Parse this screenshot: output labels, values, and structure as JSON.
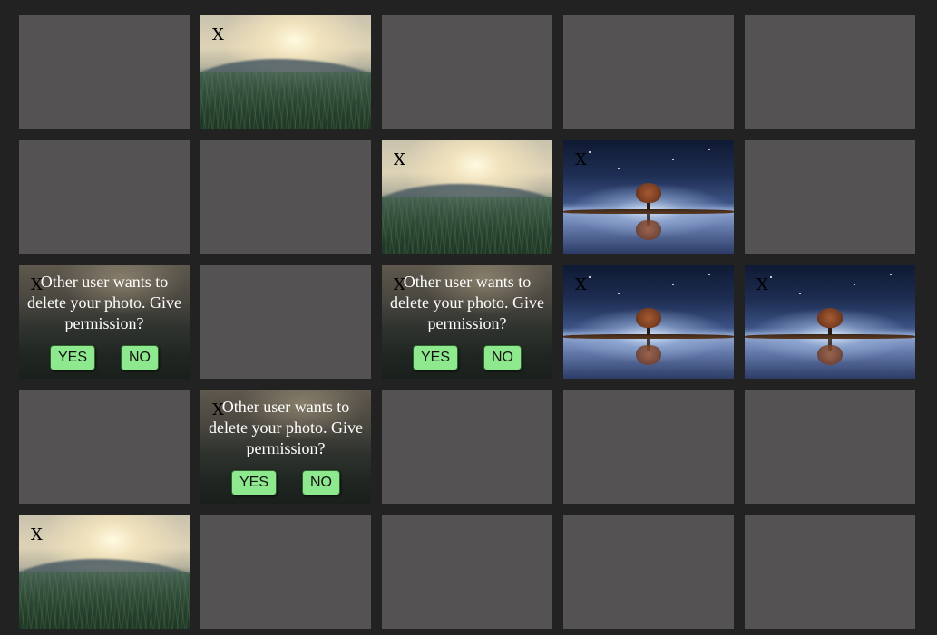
{
  "close_label": "X",
  "permission": {
    "message": "Other user wants to delete your photo. Give permission?",
    "yes_label": "YES",
    "no_label": "NO"
  },
  "colors": {
    "page_background": "#222222",
    "empty_tile": "#545253",
    "button_green": "#8ee88e"
  },
  "grid": {
    "rows": 5,
    "columns": 5,
    "tiles": [
      [
        "empty",
        "meadow",
        "empty",
        "empty",
        "empty"
      ],
      [
        "empty",
        "empty",
        "meadow",
        "tree",
        "empty"
      ],
      [
        "permission",
        "empty",
        "permission",
        "tree",
        "tree"
      ],
      [
        "empty",
        "permission",
        "empty",
        "empty",
        "empty"
      ],
      [
        "meadow",
        "empty",
        "empty",
        "empty",
        "empty"
      ]
    ]
  }
}
